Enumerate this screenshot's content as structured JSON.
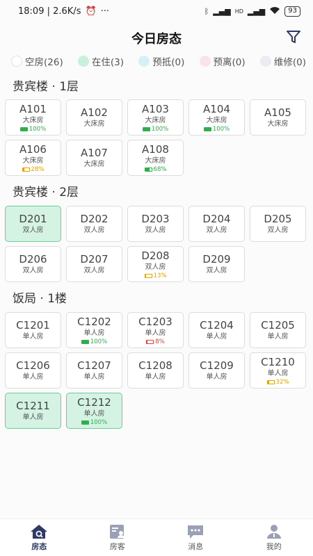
{
  "status_bar": {
    "time": "18:09 | 2.6K/s",
    "dots": "···",
    "battery": "93",
    "net": "HD"
  },
  "header": {
    "title": "今日房态"
  },
  "legend": [
    {
      "label": "空房(26)",
      "color": "#ffffff"
    },
    {
      "label": "在住(3)",
      "color": "#c9f0dd"
    },
    {
      "label": "预抵(0)",
      "color": "#d7f0f8"
    },
    {
      "label": "预离(0)",
      "color": "#fbe4e7"
    },
    {
      "label": "维修(0)",
      "color": "#ebebf3"
    }
  ],
  "colors": {
    "occupied_bg": "#d4f3e3",
    "battery_green": "#2db04a",
    "battery_orange": "#e8a000",
    "battery_red": "#e0403a",
    "accent": "#2e3a66"
  },
  "sections": [
    {
      "title": "贵宾楼 · 1层",
      "rooms": [
        {
          "number": "A101",
          "type": "大床房",
          "battery": "100%",
          "battery_level": 1.0,
          "battery_color": "green",
          "occupied": false
        },
        {
          "number": "A102",
          "type": "大床房",
          "battery": "",
          "occupied": false
        },
        {
          "number": "A103",
          "type": "大床房",
          "battery": "100%",
          "battery_level": 1.0,
          "battery_color": "green",
          "occupied": false
        },
        {
          "number": "A104",
          "type": "大床房",
          "battery": "100%",
          "battery_level": 1.0,
          "battery_color": "green",
          "occupied": false
        },
        {
          "number": "A105",
          "type": "大床房",
          "battery": "",
          "occupied": false
        },
        {
          "number": "A106",
          "type": "大床房",
          "battery": "28%",
          "battery_level": 0.28,
          "battery_color": "orange",
          "occupied": false
        },
        {
          "number": "A107",
          "type": "大床房",
          "battery": "",
          "occupied": false
        },
        {
          "number": "A108",
          "type": "大床房",
          "battery": "68%",
          "battery_level": 0.68,
          "battery_color": "green",
          "occupied": false
        }
      ]
    },
    {
      "title": "贵宾楼 · 2层",
      "rooms": [
        {
          "number": "D201",
          "type": "双人房",
          "battery": "",
          "occupied": true
        },
        {
          "number": "D202",
          "type": "双人房",
          "battery": "",
          "occupied": false
        },
        {
          "number": "D203",
          "type": "双人房",
          "battery": "",
          "occupied": false
        },
        {
          "number": "D204",
          "type": "双人房",
          "battery": "",
          "occupied": false
        },
        {
          "number": "D205",
          "type": "双人房",
          "battery": "",
          "occupied": false
        },
        {
          "number": "D206",
          "type": "双人房",
          "battery": "",
          "occupied": false
        },
        {
          "number": "D207",
          "type": "双人房",
          "battery": "",
          "occupied": false
        },
        {
          "number": "D208",
          "type": "双人房",
          "battery": "13%",
          "battery_level": 0.13,
          "battery_color": "orange",
          "occupied": false
        },
        {
          "number": "D209",
          "type": "双人房",
          "battery": "",
          "occupied": false
        }
      ]
    },
    {
      "title": "饭局 · 1楼",
      "rooms": [
        {
          "number": "C1201",
          "type": "单人房",
          "battery": "",
          "occupied": false
        },
        {
          "number": "C1202",
          "type": "单人房",
          "battery": "100%",
          "battery_level": 1.0,
          "battery_color": "green",
          "occupied": false
        },
        {
          "number": "C1203",
          "type": "单人房",
          "battery": "8%",
          "battery_level": 0.08,
          "battery_color": "red",
          "occupied": false
        },
        {
          "number": "C1204",
          "type": "单人房",
          "battery": "",
          "occupied": false
        },
        {
          "number": "C1205",
          "type": "单人房",
          "battery": "",
          "occupied": false
        },
        {
          "number": "C1206",
          "type": "单人房",
          "battery": "",
          "occupied": false
        },
        {
          "number": "C1207",
          "type": "单人房",
          "battery": "",
          "occupied": false
        },
        {
          "number": "C1208",
          "type": "单人房",
          "battery": "",
          "occupied": false
        },
        {
          "number": "C1209",
          "type": "单人房",
          "battery": "",
          "occupied": false
        },
        {
          "number": "C1210",
          "type": "单人房",
          "battery": "32%",
          "battery_level": 0.32,
          "battery_color": "orange",
          "occupied": false
        },
        {
          "number": "C1211",
          "type": "单人房",
          "battery": "",
          "occupied": true
        },
        {
          "number": "C1212",
          "type": "单人房",
          "battery": "100%",
          "battery_level": 1.0,
          "battery_color": "green",
          "occupied": true
        }
      ]
    }
  ],
  "tabs": [
    {
      "label": "房态",
      "icon": "house-icon",
      "active": true
    },
    {
      "label": "房客",
      "icon": "guest-card-icon",
      "active": false
    },
    {
      "label": "消息",
      "icon": "message-icon",
      "active": false
    },
    {
      "label": "我的",
      "icon": "profile-icon",
      "active": false
    }
  ]
}
